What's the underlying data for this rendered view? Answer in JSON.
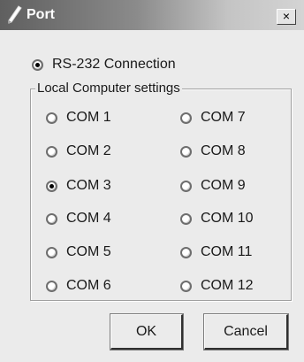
{
  "window": {
    "title": "Port",
    "close_label": "×"
  },
  "connection": {
    "label": "RS-232 Connection",
    "selected": true
  },
  "group": {
    "legend": "Local Computer settings"
  },
  "ports": [
    {
      "label": "COM 1",
      "selected": false
    },
    {
      "label": "COM 2",
      "selected": false
    },
    {
      "label": "COM 3",
      "selected": true
    },
    {
      "label": "COM 4",
      "selected": false
    },
    {
      "label": "COM 5",
      "selected": false
    },
    {
      "label": "COM 6",
      "selected": false
    },
    {
      "label": "COM 7",
      "selected": false
    },
    {
      "label": "COM 8",
      "selected": false
    },
    {
      "label": "COM 9",
      "selected": false
    },
    {
      "label": "COM 10",
      "selected": false
    },
    {
      "label": "COM 11",
      "selected": false
    },
    {
      "label": "COM 12",
      "selected": false
    }
  ],
  "buttons": {
    "ok": "OK",
    "cancel": "Cancel"
  }
}
